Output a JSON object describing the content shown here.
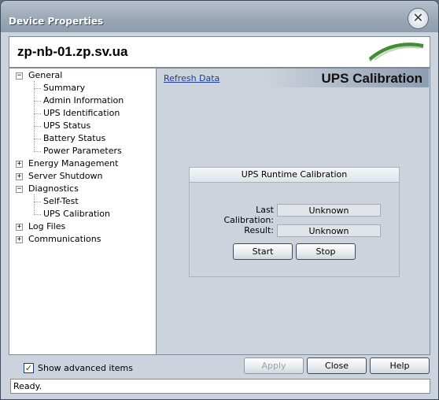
{
  "window": {
    "title": "Device Properties"
  },
  "header": {
    "hostname": "zp-nb-01.zp.sv.ua"
  },
  "tree": {
    "items": [
      {
        "label": "General",
        "level": 0,
        "expander": "−"
      },
      {
        "label": "Summary",
        "level": 1
      },
      {
        "label": "Admin Information",
        "level": 1
      },
      {
        "label": "UPS Identification",
        "level": 1
      },
      {
        "label": "UPS Status",
        "level": 1
      },
      {
        "label": "Battery Status",
        "level": 1
      },
      {
        "label": "Power Parameters",
        "level": 1
      },
      {
        "label": "Energy Management",
        "level": 0,
        "expander": "+"
      },
      {
        "label": "Server Shutdown",
        "level": 0,
        "expander": "+"
      },
      {
        "label": "Diagnostics",
        "level": 0,
        "expander": "−"
      },
      {
        "label": "Self-Test",
        "level": 1
      },
      {
        "label": "UPS Calibration",
        "level": 1
      },
      {
        "label": "Log Files",
        "level": 0,
        "expander": "+"
      },
      {
        "label": "Communications",
        "level": 0,
        "expander": "+"
      }
    ]
  },
  "content": {
    "refresh_link": "Refresh Data",
    "title": "UPS Calibration",
    "group": {
      "title": "UPS Runtime Calibration",
      "last_calibration_label": "Last Calibration:",
      "last_calibration_value": "Unknown",
      "result_label": "Result:",
      "result_value": "Unknown",
      "start_label": "Start",
      "stop_label": "Stop"
    }
  },
  "footer": {
    "show_advanced_label": "Show advanced items",
    "show_advanced_checked": true,
    "apply_label": "Apply",
    "close_label": "Close",
    "help_label": "Help"
  },
  "status": {
    "text": "Ready."
  },
  "colors": {
    "accent_green": "#3f8f2e",
    "link": "#1a3c9e"
  }
}
